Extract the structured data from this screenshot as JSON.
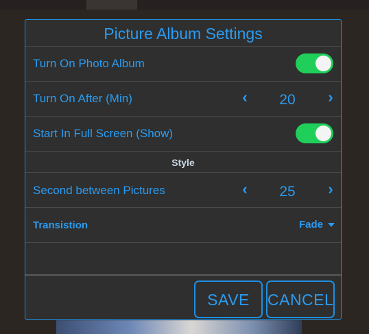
{
  "dialog": {
    "title": "Picture Album Settings"
  },
  "rows": {
    "photo_album": {
      "label": "Turn On Photo Album",
      "enabled": true
    },
    "turn_on_after": {
      "label": "Turn On After (Min)",
      "value": "20"
    },
    "full_screen": {
      "label": "Start In Full Screen (Show)",
      "enabled": true
    },
    "style_header": "Style",
    "seconds_between": {
      "label": "Second between Pictures",
      "value": "25"
    },
    "transition": {
      "label": "Transistion",
      "value": "Fade"
    }
  },
  "buttons": {
    "save": "SAVE",
    "cancel": "CANCEL"
  },
  "icons": {
    "decrement": "chevron-left-icon",
    "increment": "chevron-right-icon",
    "dropdown": "caret-down-icon"
  },
  "colors": {
    "accent": "#2a9cf2",
    "toggle_on": "#1fcf5a",
    "dialog_bg": "#2f2f2f"
  }
}
